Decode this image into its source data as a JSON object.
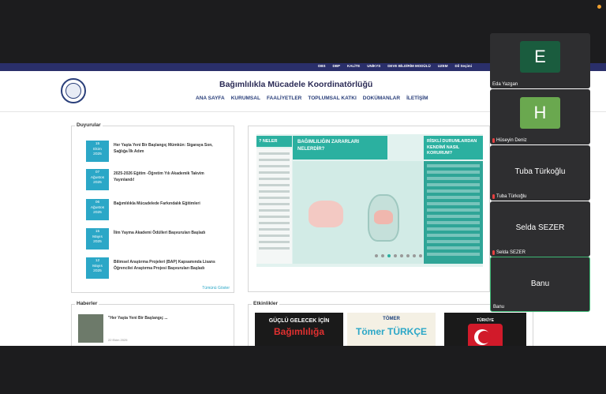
{
  "site": {
    "topbar_links": [
      "OBS",
      "DBP",
      "KALİTE",
      "UNİKYS",
      "DEVE BİLDİRİM MODÜLÜ",
      "UZEM",
      "Dil Seçimi"
    ],
    "title": "Bağımlılıkla Mücadele Koordinatörlüğü",
    "nav": [
      "ANA SAYFA",
      "KURUMSAL",
      "FAALİYETLER",
      "TOPLUMSAL KATKI",
      "DOKÜMANLAR",
      "İLETİŞİM"
    ]
  },
  "announcements": {
    "title": "Duyurular",
    "items": [
      {
        "day": "15",
        "month": "Ekim",
        "year": "2025",
        "text": "Her Yaşta Yeni Bir Başlangıç Mümkün: Sigaraya Son, Sağlığa İlk Adım"
      },
      {
        "day": "07",
        "month": "Ağustos",
        "year": "2025",
        "text": "2025-2026 Eğitim -Öğretim Yılı Akademik Takvim Yayınlandı!"
      },
      {
        "day": "06",
        "month": "Ağustos",
        "year": "2025",
        "text": "Bağımlılıkla Mücadelede Farkındalık Eğitimleri"
      },
      {
        "day": "15",
        "month": "Mayıs",
        "year": "2025",
        "text": "İlim Yayma Akademi Ödülleri Başvuruları Başladı"
      },
      {
        "day": "12",
        "month": "Mayıs",
        "year": "2025",
        "text": "Bilimsel Araştırma Projeleri (BAP) Kapsamında Lisans Öğrencilei Araştırma Projesi Başvuruları Başladı"
      }
    ],
    "all_link": "Tümünü Göster"
  },
  "infographic": {
    "left_head": "? NELER",
    "mid_head": "BAĞIMLILIĞIN ZARARLARI NELERDİR?",
    "right_head": "RİSKLİ DURUMLARDAN KENDİMİ NASIL KORURUM?"
  },
  "news": {
    "title": "Haberler",
    "item_title": "\"Her Yaşta Yeni Bir Başlangıç ...",
    "item_date": "22 Ekim 2025"
  },
  "events": {
    "title": "Etkinlikler",
    "ev1_top": "GÜÇLÜ GELECEK İÇİN",
    "ev1_big": "Bağımlılığa",
    "ev2_top": "TÖMER",
    "ev2_big": "Tömer TÜRKÇE",
    "ev3_top": "TÜRKİYE"
  },
  "participants": [
    {
      "initial": "E",
      "name": "Eda Yazgan",
      "color": "#1a5c3e",
      "muted": false
    },
    {
      "initial": "H",
      "name": "Hüseyin Deniz",
      "color": "#6aa84f",
      "muted": true
    },
    {
      "display": "Tuba Türkoğlu",
      "name": "Tuba Türkoğlu",
      "muted": true
    },
    {
      "display": "Selda SEZER",
      "name": "Selda SEZER",
      "muted": true
    },
    {
      "display": "Banu",
      "name": "Banu",
      "muted": false
    }
  ]
}
